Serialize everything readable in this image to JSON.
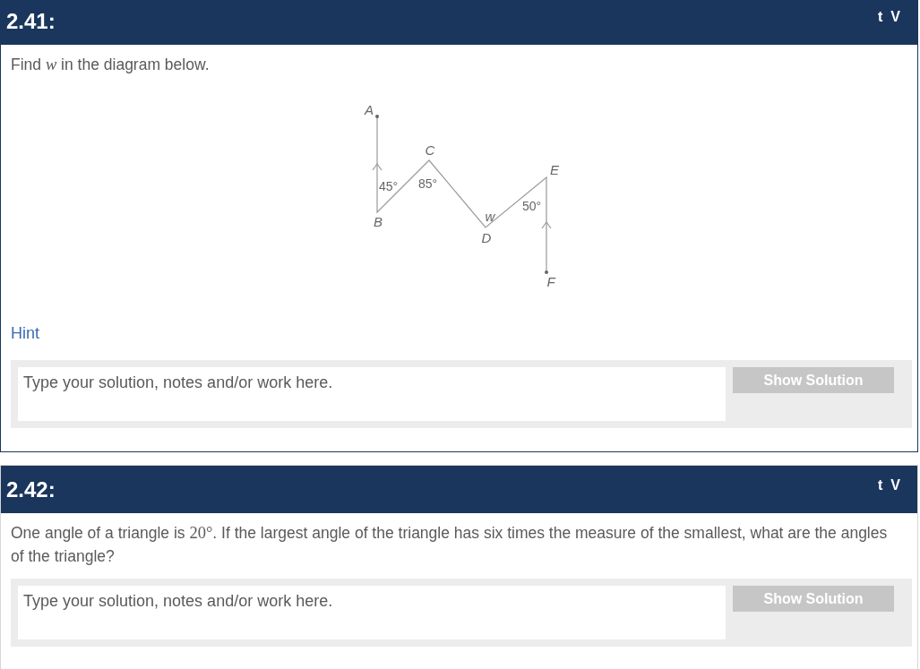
{
  "questions": [
    {
      "number": "2.41:",
      "actions": [
        "t",
        "V"
      ],
      "focused": true,
      "prompt": [
        {
          "kind": "text",
          "text": "Find "
        },
        {
          "kind": "math",
          "text": "*w*"
        },
        {
          "kind": "text",
          "text": " in the diagram below."
        }
      ],
      "diagram": {
        "point_labels": [
          "A",
          "B",
          "C",
          "D",
          "E",
          "F"
        ],
        "angle_labels": [
          {
            "kind": "degree",
            "text": "45°"
          },
          {
            "kind": "degree",
            "text": "85°"
          },
          {
            "kind": "variable",
            "text": "w"
          },
          {
            "kind": "degree",
            "text": "50°"
          }
        ]
      },
      "hint": "Hint",
      "answer": {
        "placeholder": "Type your solution, notes and/or work here."
      },
      "solution_button": "Show Solution"
    },
    {
      "number": "2.42:",
      "actions": [
        "t",
        "V"
      ],
      "focused": false,
      "prompt": [
        {
          "kind": "text",
          "text": "One angle of a triangle is "
        },
        {
          "kind": "math",
          "text": "20°"
        },
        {
          "kind": "text",
          "text": ". If the largest angle of the triangle has six times the measure of the smallest, what are the angles of the triangle?"
        }
      ],
      "answer": {
        "placeholder": "Type your solution, notes and/or work here."
      },
      "solution_button": "Show Solution"
    }
  ]
}
